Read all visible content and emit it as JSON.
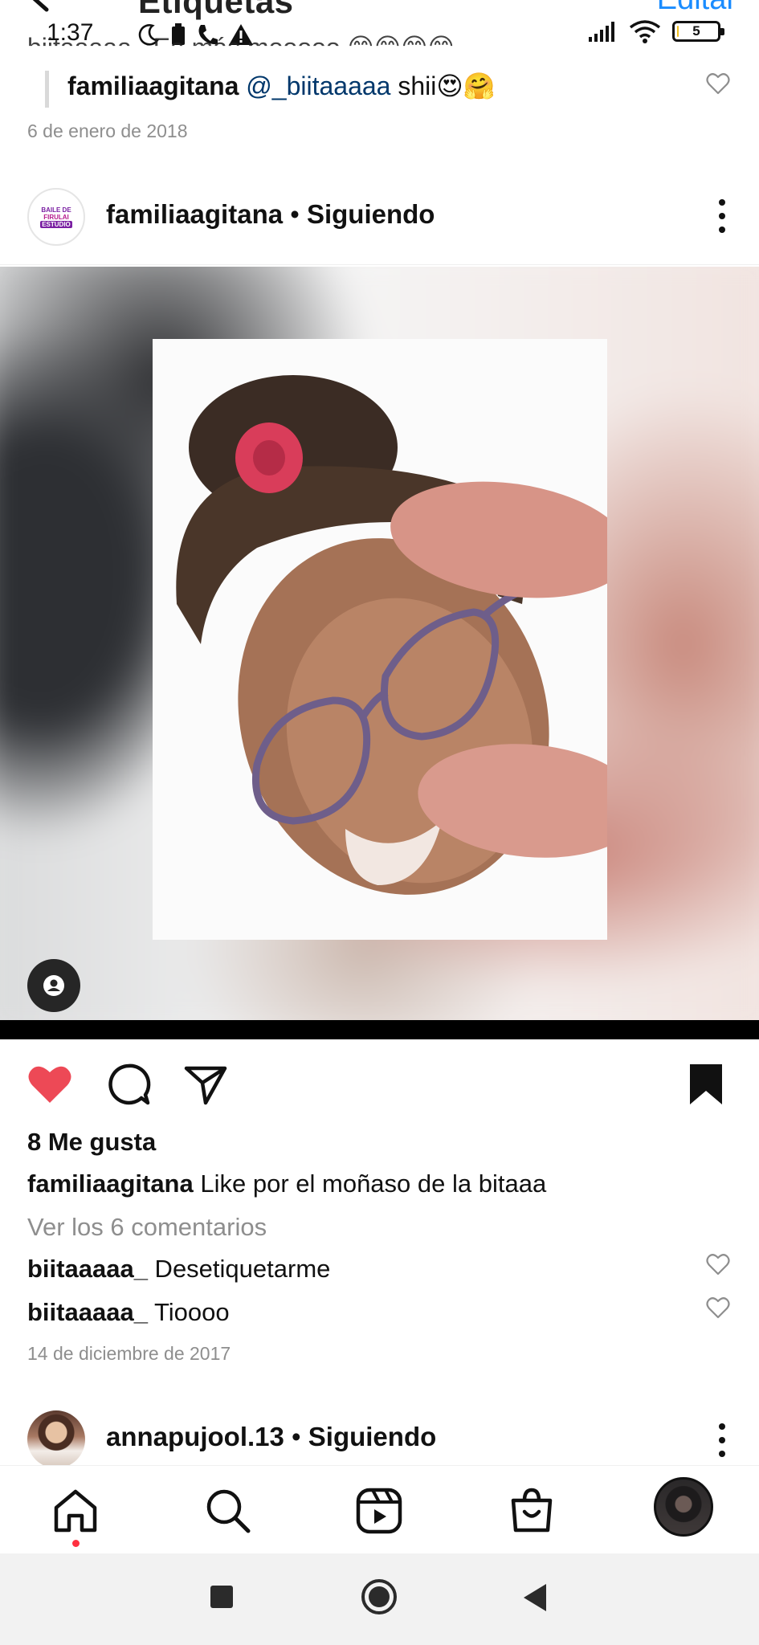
{
  "status_bar": {
    "time": "1:37",
    "battery_level": "5",
    "battery_fraction": 0.05,
    "icons": [
      "moon-icon",
      "sim-icon",
      "phone-icon",
      "warning-icon",
      "signal-icon",
      "wifi-icon",
      "battery-icon"
    ]
  },
  "header": {
    "title": "Etiquetas",
    "edit_label": "Editar"
  },
  "previous_post": {
    "cut_comment": "biitaaaaa_ Ea más mooooo 😊😊😊😊",
    "reply": {
      "username": "familiaagitana",
      "mention": "@_biitaaaaa",
      "text": " shii😍🤗"
    },
    "date": "6 de enero de 2018"
  },
  "post": {
    "username": "familiaagitana",
    "separator": " • ",
    "follow_status": "Siguiendo",
    "avatar_logo_lines": [
      "BAILE DE",
      "FIRULAI",
      "ESTUDIO"
    ],
    "likes": "8 Me gusta",
    "caption_user": "familiaagitana",
    "caption_text": " Like por el moñaso de la bitaaa",
    "view_comments": "Ver los 6 comentarios",
    "comments": [
      {
        "username": "biitaaaaa_",
        "text": " Desetiquetarme"
      },
      {
        "username": "biitaaaaa_",
        "text": " Tioooo"
      }
    ],
    "date": "14 de diciembre de 2017",
    "liked": true,
    "saved": true
  },
  "next_post": {
    "username": "annapujool.13",
    "separator": " • ",
    "follow_status": "Siguiendo"
  },
  "tabs": [
    "home",
    "search",
    "reels",
    "shop",
    "profile"
  ],
  "colors": {
    "like": "#ed4956",
    "mention": "#00376b",
    "edit": "#1a8cff",
    "muted": "#8e8e8e",
    "notification_dot": "#ff3040"
  }
}
